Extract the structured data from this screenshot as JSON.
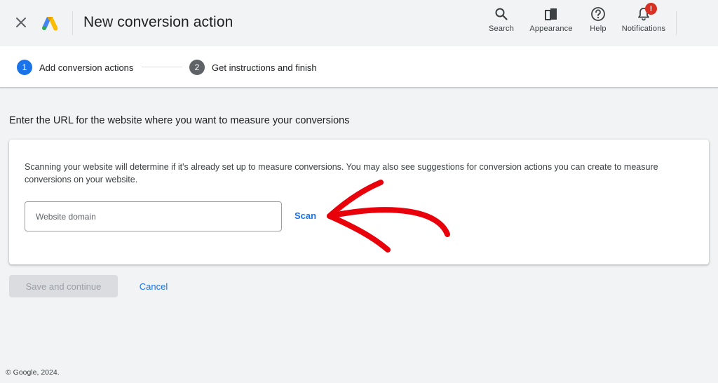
{
  "header": {
    "title": "New conversion action",
    "close_icon": "close-icon",
    "logo_icon": "google-ads-logo",
    "tools": [
      {
        "label": "Search",
        "icon": "search-icon"
      },
      {
        "label": "Appearance",
        "icon": "appearance-icon"
      },
      {
        "label": "Help",
        "icon": "help-icon"
      },
      {
        "label": "Notifications",
        "icon": "bell-icon",
        "badge": "!"
      }
    ]
  },
  "stepper": {
    "steps": [
      {
        "number": "1",
        "label": "Add conversion actions",
        "state": "active",
        "color": "#1a73e8"
      },
      {
        "number": "2",
        "label": "Get instructions and finish",
        "state": "inactive",
        "color": "#5f6368"
      }
    ]
  },
  "main": {
    "instruction": "Enter the URL for the website where you want to measure your conversions",
    "card": {
      "description": "Scanning your website will determine if it's already set up to measure conversions. You may also see suggestions for conversion actions you can create to measure conversions on your website.",
      "domain_placeholder": "Website domain",
      "domain_value": "",
      "scan_label": "Scan"
    },
    "annotation_arrow_color": "#e8000b",
    "save_label": "Save and continue",
    "cancel_label": "Cancel"
  },
  "footer": {
    "copyright": "© Google, 2024."
  },
  "colors": {
    "accent": "#1a73e8",
    "badge": "#d93025",
    "background": "#f1f3f4"
  }
}
